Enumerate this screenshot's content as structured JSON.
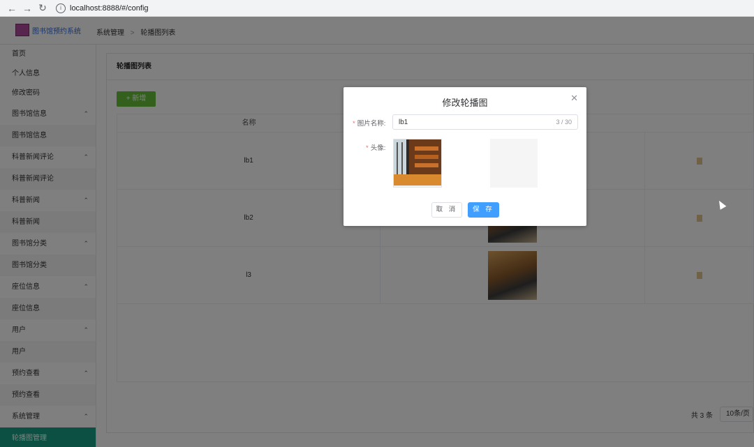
{
  "browser": {
    "url": "localhost:8888/#/config"
  },
  "header": {
    "app_title": "图书馆预约系统",
    "breadcrumb": [
      "系统管理",
      "轮播图列表"
    ]
  },
  "sidebar": {
    "items": [
      {
        "label": "首页",
        "type": "item"
      },
      {
        "label": "个人信息",
        "type": "item"
      },
      {
        "label": "修改密码",
        "type": "item"
      },
      {
        "label": "图书馆信息",
        "type": "group"
      },
      {
        "label": "图书馆信息",
        "type": "sub"
      },
      {
        "label": "科普新闻评论",
        "type": "group"
      },
      {
        "label": "科普新闻评论",
        "type": "sub"
      },
      {
        "label": "科普新闻",
        "type": "group"
      },
      {
        "label": "科普新闻",
        "type": "sub"
      },
      {
        "label": "图书馆分类",
        "type": "group"
      },
      {
        "label": "图书馆分类",
        "type": "sub"
      },
      {
        "label": "座位信息",
        "type": "group"
      },
      {
        "label": "座位信息",
        "type": "sub"
      },
      {
        "label": "用户",
        "type": "group"
      },
      {
        "label": "用户",
        "type": "sub"
      },
      {
        "label": "预约查看",
        "type": "group"
      },
      {
        "label": "预约查看",
        "type": "sub"
      },
      {
        "label": "系统管理",
        "type": "group"
      },
      {
        "label": "轮播图管理",
        "type": "active"
      }
    ]
  },
  "main": {
    "panel_title": "轮播图列表",
    "add_button": "+ 新增",
    "table": {
      "headers": [
        "名称"
      ],
      "rows": [
        {
          "name": "lb1"
        },
        {
          "name": "lb2"
        },
        {
          "name": "l3"
        }
      ]
    },
    "pager": {
      "total": "共 3 条",
      "page_size": "10条/页"
    }
  },
  "dialog": {
    "title": "修改轮播图",
    "close_icon": "close-icon",
    "name_label": "图片名称:",
    "name_value": "lb1",
    "name_count": "3 / 30",
    "image_label": "头像:",
    "cancel_label": "取 消",
    "save_label": "保 存"
  },
  "colors": {
    "accent": "#409eff",
    "add_button": "#67c23a",
    "sidebar_active": "#16a085",
    "required": "#f56c6c"
  }
}
